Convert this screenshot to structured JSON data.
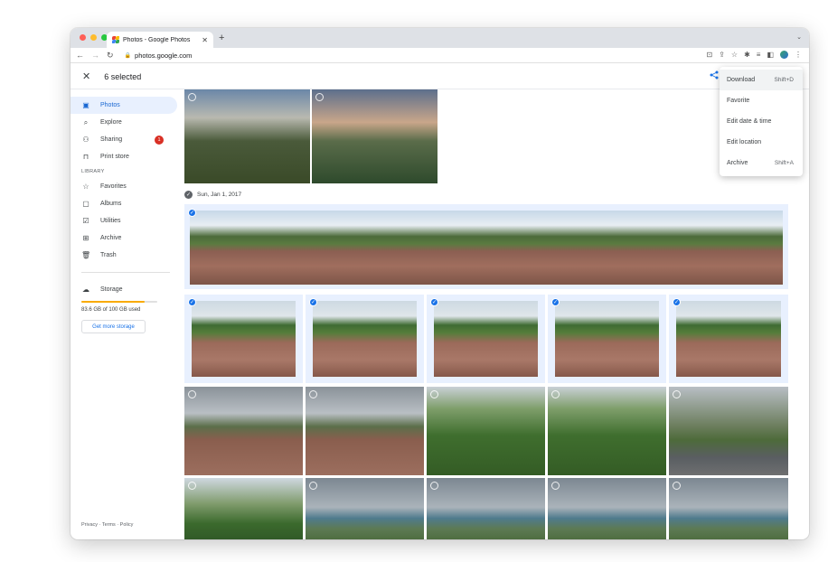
{
  "browser": {
    "tab_title": "Photos - Google Photos",
    "url": "photos.google.com",
    "traffic_lights": [
      "#ff5f57",
      "#febc2e",
      "#28c840"
    ]
  },
  "header": {
    "selection_count": "6 selected"
  },
  "sidebar": {
    "items": [
      {
        "label": "Photos",
        "icon": "photo-icon"
      },
      {
        "label": "Explore",
        "icon": "search-icon"
      },
      {
        "label": "Sharing",
        "icon": "people-icon",
        "badge": "1"
      },
      {
        "label": "Print store",
        "icon": "shopping-bag-icon"
      }
    ],
    "library_label": "LIBRARY",
    "library_items": [
      {
        "label": "Favorites",
        "icon": "star-icon"
      },
      {
        "label": "Albums",
        "icon": "album-icon"
      },
      {
        "label": "Utilities",
        "icon": "utilities-icon"
      },
      {
        "label": "Archive",
        "icon": "archive-icon"
      },
      {
        "label": "Trash",
        "icon": "trash-icon"
      }
    ],
    "storage": {
      "label": "Storage",
      "used_text": "83.6 GB of 100 GB used",
      "used_fraction": 0.836,
      "button": "Get more storage"
    },
    "footer": "Privacy · Terms · Policy"
  },
  "content": {
    "date_header": "Sun, Jan 1, 2017"
  },
  "menu": {
    "items": [
      {
        "label": "Download",
        "shortcut": "Shift+D"
      },
      {
        "label": "Favorite",
        "shortcut": ""
      },
      {
        "label": "Edit date & time",
        "shortcut": ""
      },
      {
        "label": "Edit location",
        "shortcut": ""
      },
      {
        "label": "Archive",
        "shortcut": "Shift+A"
      }
    ]
  },
  "colors": {
    "accent": "#1a73e8",
    "selection_bg": "#e8f0fe",
    "badge": "#d93025",
    "storage": "#f9ab00"
  }
}
